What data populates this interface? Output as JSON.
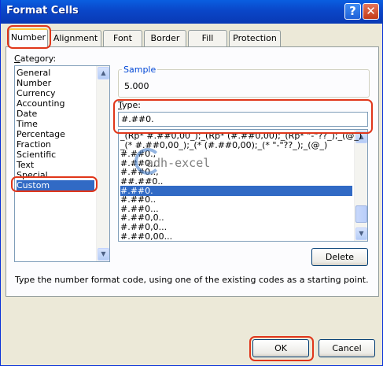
{
  "window": {
    "title": "Format Cells",
    "help_glyph": "?",
    "close_glyph": "✕"
  },
  "tabs": [
    {
      "label": "Number"
    },
    {
      "label": "Alignment"
    },
    {
      "label": "Font"
    },
    {
      "label": "Border"
    },
    {
      "label": "Fill"
    },
    {
      "label": "Protection"
    }
  ],
  "category": {
    "label_first": "C",
    "label_rest": "ategory:",
    "items": [
      "General",
      "Number",
      "Currency",
      "Accounting",
      "Date",
      "Time",
      "Percentage",
      "Fraction",
      "Scientific",
      "Text",
      "Special",
      "Custom"
    ],
    "selected": "Custom"
  },
  "sample": {
    "label": "Sample",
    "value": "5.000"
  },
  "type": {
    "label_first": "T",
    "label_rest": "ype:",
    "value": "#.##0.",
    "items": [
      "_(Rp* #.##0,00_);_(Rp* (#.##0,00);_(Rp* \"-\"??_);_(@_)",
      "_(* #.##0,00_);_(* (#.##0,00);_(* \"-\"??_);_(@_)",
      "#.##0.,",
      "#.##0,,",
      "#.##0..,",
      "##.##0..",
      "#.##0.",
      "#.##0..",
      "#.##0...",
      "#.##0,0..",
      "#.##0,0...",
      "#.##0,00..."
    ],
    "selected": "#.##0."
  },
  "delete_button": {
    "label": "Delete"
  },
  "hint_text": "Type the number format code, using one of the existing codes as a starting point.",
  "ok_button": {
    "label": "OK"
  },
  "cancel_button": {
    "label": "Cancel"
  },
  "watermark": "adh-excel",
  "scroll_glyphs": {
    "up": "▲",
    "down": "▼"
  },
  "colors": {
    "title_bar": "#0a46c8",
    "selection": "#316ac5",
    "highlight": "#e0361a",
    "dialog_bg": "#ece9d8"
  }
}
